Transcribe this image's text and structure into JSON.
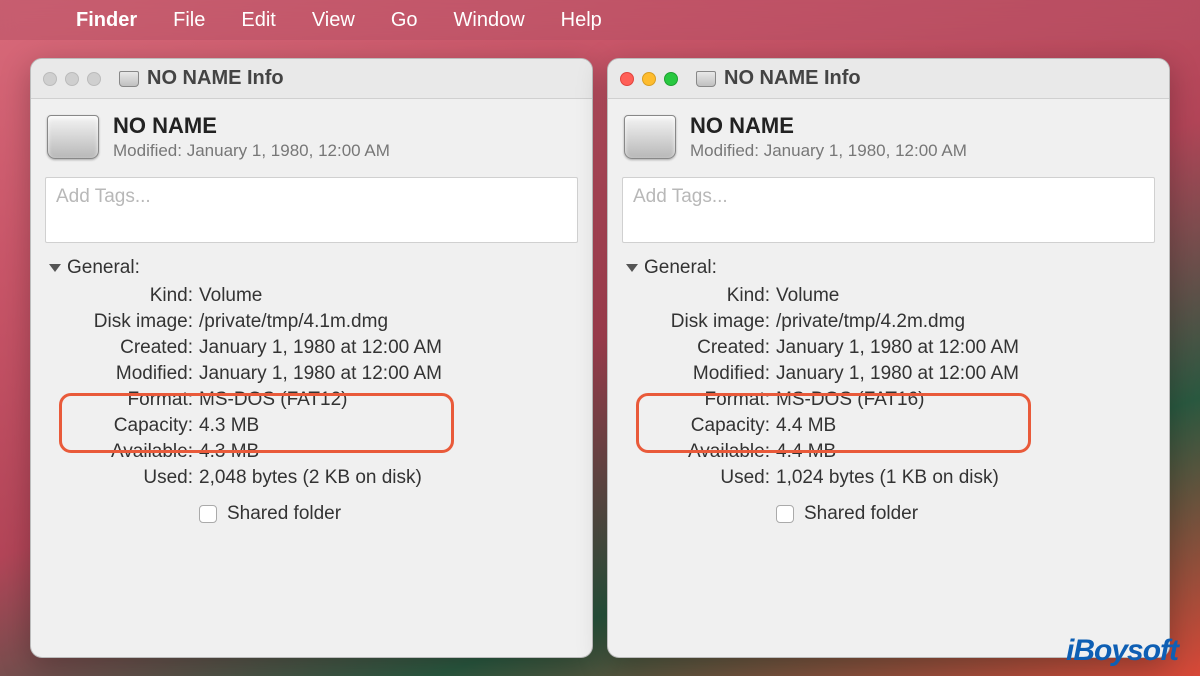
{
  "menubar": {
    "app": "Finder",
    "items": [
      "File",
      "Edit",
      "View",
      "Go",
      "Window",
      "Help"
    ]
  },
  "windows": [
    {
      "active": false,
      "title": "NO NAME Info",
      "volume_name": "NO NAME",
      "modified_header": "Modified: January 1, 1980, 12:00 AM",
      "tags_placeholder": "Add Tags...",
      "section_label": "General:",
      "fields": {
        "kind_label": "Kind:",
        "kind": "Volume",
        "diskimage_label": "Disk image:",
        "diskimage": "/private/tmp/4.1m.dmg",
        "created_label": "Created:",
        "created": "January 1, 1980 at 12:00 AM",
        "modified_label": "Modified:",
        "modified": "January 1, 1980 at 12:00 AM",
        "format_label": "Format:",
        "format": "MS-DOS (FAT12)",
        "capacity_label": "Capacity:",
        "capacity": "4.3 MB",
        "available_label": "Available:",
        "available": "4.3 MB",
        "used_label": "Used:",
        "used": "2,048 bytes (2 KB on disk)"
      },
      "shared_label": "Shared folder"
    },
    {
      "active": true,
      "title": "NO NAME Info",
      "volume_name": "NO NAME",
      "modified_header": "Modified: January 1, 1980, 12:00 AM",
      "tags_placeholder": "Add Tags...",
      "section_label": "General:",
      "fields": {
        "kind_label": "Kind:",
        "kind": "Volume",
        "diskimage_label": "Disk image:",
        "diskimage": "/private/tmp/4.2m.dmg",
        "created_label": "Created:",
        "created": "January 1, 1980 at 12:00 AM",
        "modified_label": "Modified:",
        "modified": "January 1, 1980 at 12:00 AM",
        "format_label": "Format:",
        "format": "MS-DOS (FAT16)",
        "capacity_label": "Capacity:",
        "capacity": "4.4 MB",
        "available_label": "Available:",
        "available": "4.4 MB",
        "used_label": "Used:",
        "used": "1,024 bytes (1 KB on disk)"
      },
      "shared_label": "Shared folder"
    }
  ],
  "watermark": "iBoysoft"
}
